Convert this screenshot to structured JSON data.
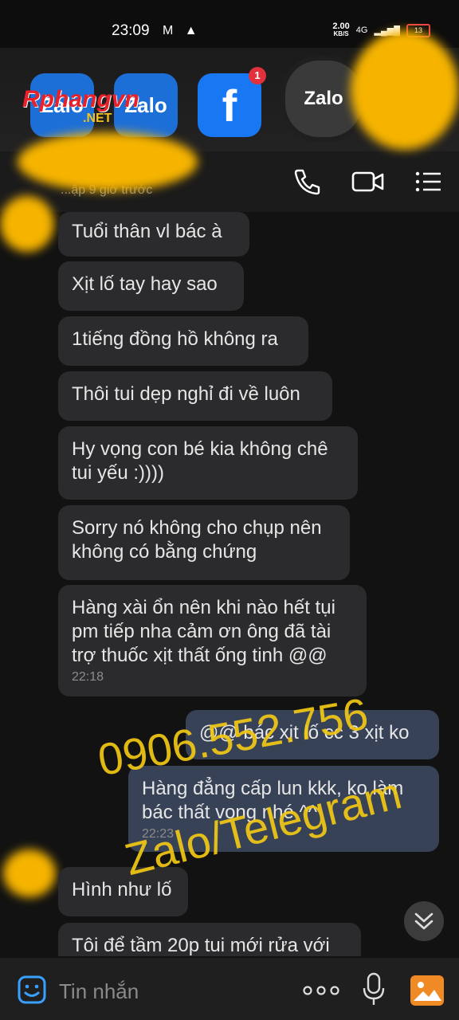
{
  "status_bar": {
    "time": "23:09",
    "net_speed": "2.00",
    "net_unit": "KB/S",
    "network": "4G",
    "battery": "13"
  },
  "watermark_logo": {
    "brand": "Rphangvn",
    "tld": ".NET"
  },
  "recent_apps": [
    {
      "label": "Zalo"
    },
    {
      "label": "Zalo"
    },
    {
      "label": "f",
      "badge": "1"
    },
    {
      "label": "Zalo"
    }
  ],
  "header": {
    "subtitle": "...ập 9 giờ trước"
  },
  "messages": [
    {
      "text": "Tuổi thân vl bác à"
    },
    {
      "text": "Xịt lố tay hay sao"
    },
    {
      "text": "1tiếng đồng hồ không ra"
    },
    {
      "text": "Thôi tui dẹp nghỉ đi về luôn"
    },
    {
      "text": "Hy vọng con bé kia không chê tui yếu :))))"
    },
    {
      "text": "Sorry nó không cho chụp nên không có bằng chứng"
    },
    {
      "text": "Hàng xài ổn nên khi nào hết tụi pm tiếp nha cảm ơn ông đã tài trợ thuốc xịt thất ống tinh @@",
      "time": "22:18"
    },
    {
      "text": "@@ bác xịt lố cc 3 xịt ko"
    },
    {
      "text": "Hàng đẳng cấp  lun kkk, ko làm bác thất vọng nhé ^^",
      "time": "22:23"
    },
    {
      "text": "Hình như lố"
    },
    {
      "text": "Tôi để tầm 20p tui mới rửa với"
    }
  ],
  "watermark": {
    "phone": "0906.552.756",
    "apps": "Zalo/Telegram"
  },
  "composer": {
    "placeholder": "Tin nhắn"
  },
  "colors": {
    "accent_yellow": "#f2c814",
    "incoming_bubble": "#2b2b2d",
    "outgoing_bubble": "#384257"
  }
}
